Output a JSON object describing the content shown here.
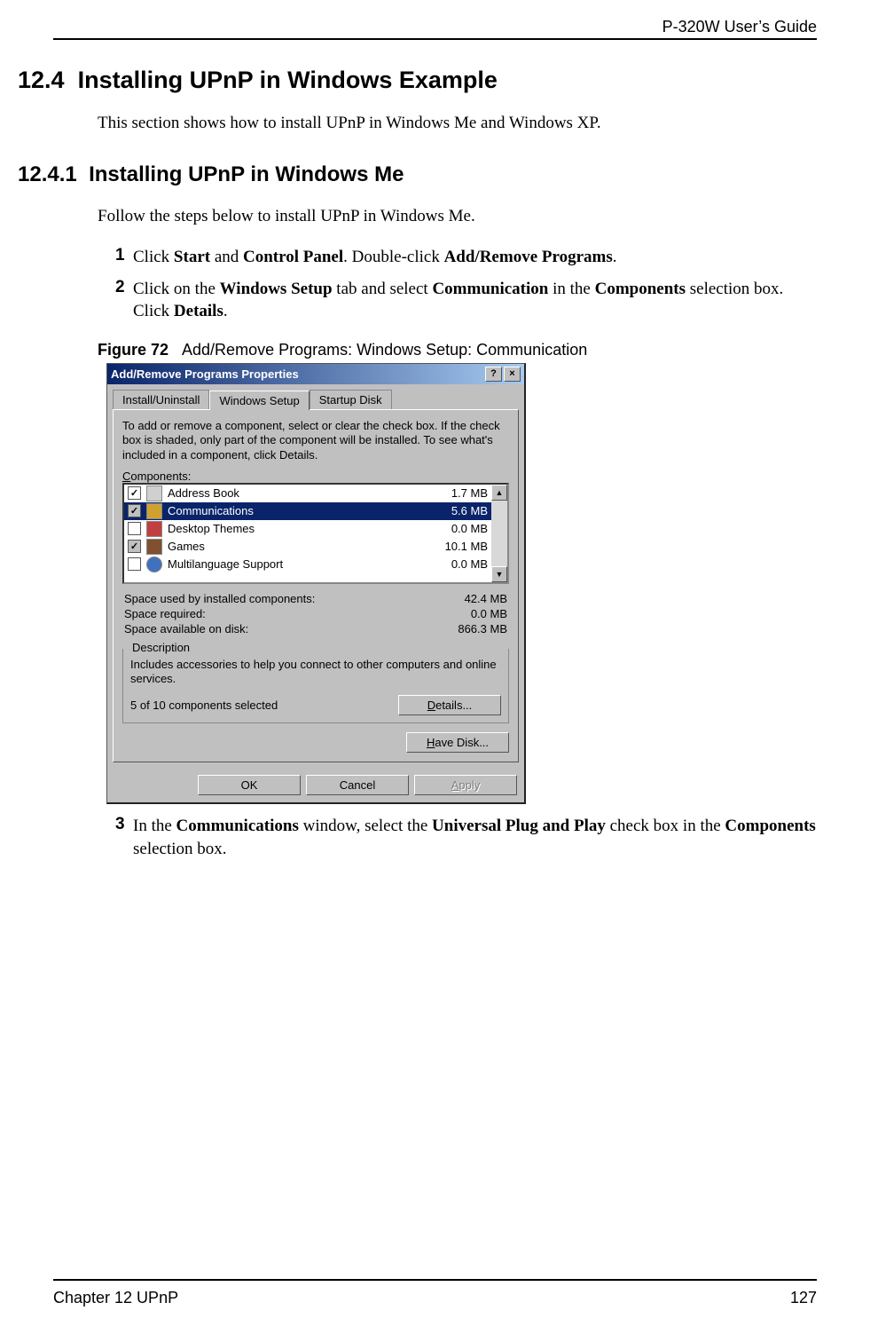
{
  "header": {
    "guide": "P-320W User’s Guide"
  },
  "section": {
    "num": "12.4",
    "title": "Installing UPnP in Windows Example",
    "intro": "This section shows how to install UPnP in Windows Me and Windows XP."
  },
  "subsection": {
    "num": "12.4.1",
    "title": "Installing UPnP in Windows Me",
    "intro": "Follow the steps below to install UPnP in Windows Me."
  },
  "steps": {
    "s1": {
      "n": "1",
      "a": "Click ",
      "b1": "Start",
      "c": " and ",
      "b2": "Control Panel",
      "d": ". Double-click ",
      "b3": "Add/Remove Programs",
      "e": "."
    },
    "s2": {
      "n": "2",
      "a": "Click on the ",
      "b1": "Windows Setup",
      "c": " tab and select ",
      "b2": "Communication",
      "d": " in the ",
      "b3": "Components",
      "e": " selection box. Click ",
      "b4": "Details",
      "f": "."
    },
    "s3": {
      "n": "3",
      "a": "In the ",
      "b1": "Communications",
      "c": " window, select the ",
      "b2": "Universal Plug and Play",
      "d": " check box in the ",
      "b3": "Components",
      "e": " selection box."
    }
  },
  "figure": {
    "num": "Figure 72",
    "caption": "Add/Remove Programs: Windows Setup: Communication"
  },
  "dialog": {
    "title": "Add/Remove Programs Properties",
    "help_btn": "?",
    "close_btn": "×",
    "tabs": {
      "t1": "Install/Uninstall",
      "t2": "Windows Setup",
      "t3": "Startup Disk"
    },
    "help_text": "To add or remove a component, select or clear the check box. If the check box is shaded, only part of the component will be installed. To see what's included in a component, click Details.",
    "components_label": "Components:",
    "items": [
      {
        "name": "Address Book",
        "size": "1.7 MB",
        "checked": "✓",
        "gray": false,
        "ico": "book"
      },
      {
        "name": "Communications",
        "size": "5.6 MB",
        "checked": "✓",
        "gray": true,
        "ico": "comm",
        "selected": true
      },
      {
        "name": "Desktop Themes",
        "size": "0.0 MB",
        "checked": "",
        "gray": false,
        "ico": "red"
      },
      {
        "name": "Games",
        "size": "10.1 MB",
        "checked": "✓",
        "gray": true,
        "ico": "game"
      },
      {
        "name": "Multilanguage Support",
        "size": "0.0 MB",
        "checked": "",
        "gray": false,
        "ico": "globe"
      }
    ],
    "stats": {
      "l1": "Space used by installed components:",
      "v1": "42.4 MB",
      "l2": "Space required:",
      "v2": "0.0 MB",
      "l3": "Space available on disk:",
      "v3": "866.3 MB"
    },
    "group_label": "Description",
    "description": "Includes accessories to help you connect to other computers and online services.",
    "subcount": "5 of 10 components selected",
    "details_btn_pre": "D",
    "details_btn_mid": "etails...",
    "havedisk_btn_pre": "H",
    "havedisk_btn_mid": "ave Disk...",
    "ok_btn": "OK",
    "cancel_btn": "Cancel",
    "apply_btn": "Apply"
  },
  "footer": {
    "chapter": "Chapter 12 UPnP",
    "page": "127"
  }
}
